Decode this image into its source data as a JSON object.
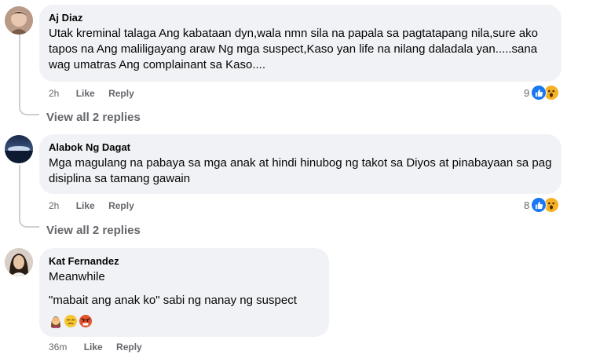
{
  "comments": [
    {
      "author": "Aj Diaz",
      "text": "Utak kreminal talaga Ang kabataan dyn,wala nmn sila na papala sa pagtatapang nila,sure ako tapos na Ang maliligayang araw Ng mga suspect,Kaso yan life na nilang daladala yan.....sana wag umatras Ang complainant sa Kaso....",
      "time": "2h",
      "like_label": "Like",
      "reply_label": "Reply",
      "reaction_count": "9",
      "reactions": [
        "like-icon",
        "wow-icon"
      ],
      "view_replies": "View all 2 replies"
    },
    {
      "author": "Alabok Ng Dagat",
      "text": "Mga magulang na pabaya sa mga anak at hindi hinubog ng takot sa Diyos at pinabayaan sa pag disiplina sa tamang gawain",
      "time": "2h",
      "like_label": "Like",
      "reply_label": "Reply",
      "reaction_count": "8",
      "reactions": [
        "like-icon",
        "wow-icon"
      ],
      "view_replies": "View all 2 replies"
    },
    {
      "author": "Kat Fernandez",
      "text_line1": "Meanwhile",
      "text_line2": "\"mabait ang anak ko\" sabi ng nanay ng suspect",
      "emojis": [
        "woman-facepalming-emoji",
        "unamused-face-emoji",
        "angry-face-emoji"
      ],
      "time": "36m",
      "like_label": "Like",
      "reply_label": "Reply"
    }
  ],
  "colors": {
    "bubble": "#f0f2f5",
    "secondary_text": "#65676b",
    "like_blue": "#1877f2",
    "wow_yellow": "#f7b125"
  }
}
